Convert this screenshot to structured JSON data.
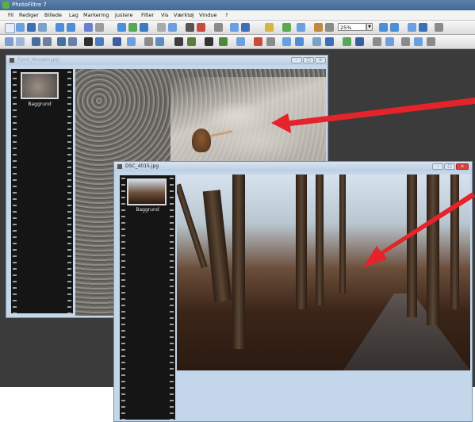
{
  "app": {
    "title": "PhotoFiltre 7",
    "menu": [
      "Fil",
      "Rediger",
      "Billede",
      "Lag",
      "Markering",
      "Justere",
      "Filter",
      "Vis",
      "Værktøj",
      "Vindue",
      "?"
    ],
    "zoom": "25%"
  },
  "window1": {
    "name": "Fjord_Hvogen.jpg",
    "layer_label": "Baggrund"
  },
  "window2": {
    "name": "DSC_4015.jpg",
    "layer_label": "Baggrund"
  },
  "colors": {
    "annotation_arrow": "#e5232a",
    "workspace": "#3b3b3b",
    "window_frame": "#c6d7e9",
    "close_button": "#d9443c"
  },
  "icons": [
    "new-file-icon",
    "open-icon",
    "save-icon",
    "print-icon",
    "undo-icon",
    "redo-icon",
    "zoom-in-icon",
    "zoom-out-icon",
    "select-icon",
    "brush-icon",
    "fill-icon",
    "text-icon"
  ]
}
